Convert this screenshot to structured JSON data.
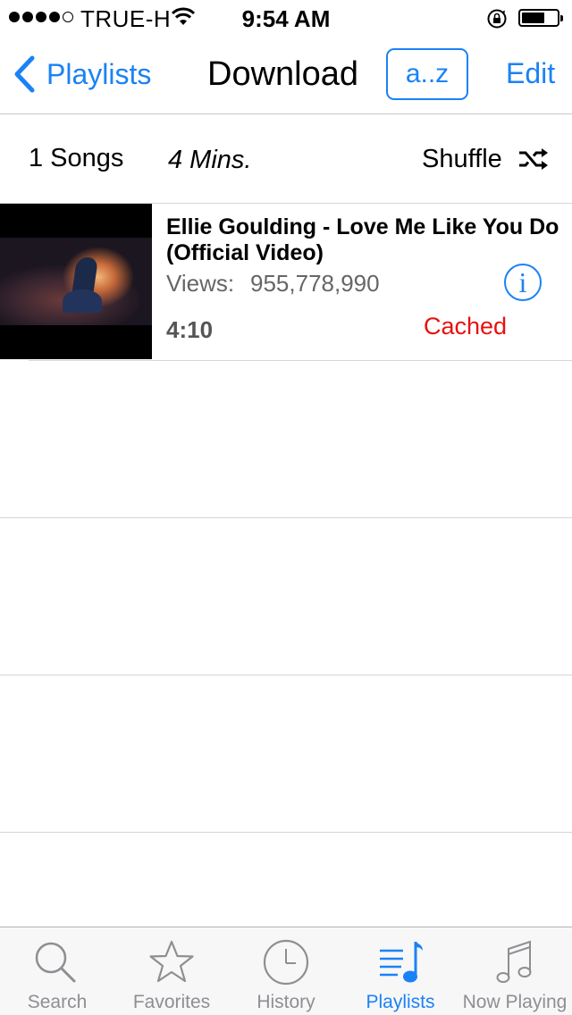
{
  "status_bar": {
    "carrier": "TRUE-H",
    "time": "9:54 AM",
    "signal_bars": 4,
    "signal_bars_total": 5,
    "battery_level": 0.6
  },
  "nav": {
    "back_label": "Playlists",
    "title": "Download",
    "sort_label": "a..z",
    "edit_label": "Edit"
  },
  "summary": {
    "songs": "1 Songs",
    "duration": "4 Mins.",
    "shuffle_label": "Shuffle"
  },
  "songs": [
    {
      "title": "Ellie Goulding - Love Me Like You Do (Official Video)",
      "views_label": "Views:",
      "views": "955,778,990",
      "duration": "4:10",
      "status": "Cached"
    }
  ],
  "tabs": [
    {
      "label": "Search",
      "icon": "magnifier-icon",
      "active": false
    },
    {
      "label": "Favorites",
      "icon": "star-icon",
      "active": false
    },
    {
      "label": "History",
      "icon": "clock-icon",
      "active": false
    },
    {
      "label": "Playlists",
      "icon": "playlist-icon",
      "active": true
    },
    {
      "label": "Now Playing",
      "icon": "music-note-icon",
      "active": false
    }
  ],
  "colors": {
    "accent": "#1a82f7",
    "cached": "#e8110e",
    "inactive_tab": "#8e8e93",
    "separator": "#d6d6da"
  }
}
